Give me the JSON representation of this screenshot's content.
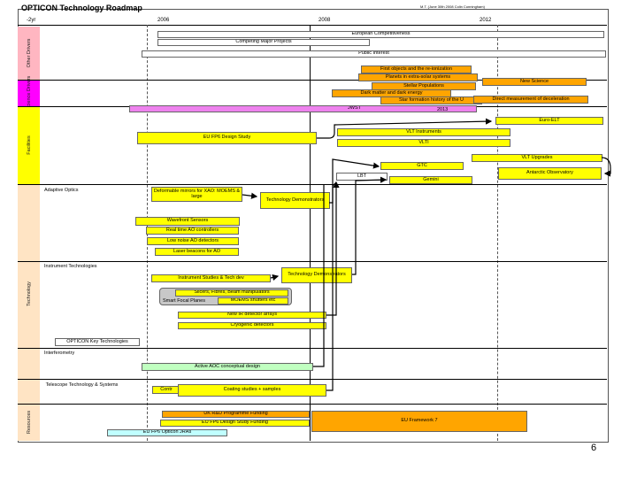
{
  "title": "OPTICON Technology Roadmap",
  "subtitle": "M.T. (June 30th 2008 Colin Cunningham)",
  "timeline": {
    "y2yr": "-2yr",
    "y2006": "2006",
    "y2008": "2008",
    "y2012": "2012"
  },
  "categories": {
    "other_drivers": "Other Drivers",
    "science_drivers": "Science Drivers",
    "facilities": "Facilities",
    "technology": "Technology",
    "resources": "Resources"
  },
  "sections": {
    "adaptive_optics": "Adaptive Optics",
    "instrument_tech": "Instrument Technologies",
    "interferometry": "Interferometry",
    "telescope_tech": "Telescope Technology & Systems"
  },
  "bars": {
    "european_comp": "European Competitiveness",
    "competing": "Competing Major Projects",
    "public_interest": "Public Interest",
    "first_objects": "First objects and the re-ionization",
    "planets": "Planets in extra-solar systems",
    "stellar_pop": "Stellar Populations",
    "new_science": "New Science",
    "dark_matter": "Dark matter and dark energy",
    "star_formation": "Star formation history of the U",
    "direct_measurement": "Direct measurement of deceleration",
    "jwst": "JWST",
    "jwst_year": "2013",
    "euro_elt": "Euro-ELT",
    "eu_fp6": "EU FP6 Design Study",
    "vlt_instruments": "VLT Instruments",
    "vlti": "VLTI",
    "vlt_upgrades": "VLT Upgrades",
    "gtc": "GTC",
    "lbt": "LBT",
    "gemini": "Gemini",
    "antarctic": "Antarctic Observatory",
    "deformable": "Deformable mirrors for XAO: MOEMS & large",
    "tech_demo_ao": "Technology Demonstrators",
    "wavefront": "Wavefront Sensors",
    "realtime": "Real time AO controllers",
    "low_noise": "Low noise AO detectors",
    "laser": "Laser beacons for AO",
    "tech_demo_inst": "Technology Demonstrators",
    "inst_studies": "Instrument Studies & Tech dev",
    "slicers": "Slicers, Fibres, Beam manipulators",
    "smart_focal": "Smart Focal Planes",
    "moems_shutters": "MOEMS shutters etc",
    "new_ir": "New IR detector arrays",
    "cryogenic": "Cryogenic detectors",
    "opticon_key": "OPTICON Key Technologies",
    "active_aoc": "Active AOC conceptual design",
    "contr": "Contr",
    "coating": "Coating studies + samples",
    "uk_rd": "UK R&D Programme Funding",
    "eu_fp6_funding": "EU FP6 Design Study Funding",
    "eu_fp7": "EU Framework 7",
    "eu_fp6_jra": "EU FP6 Opticon JRAs"
  },
  "page_number": "6",
  "colors": {
    "yellow": "#ffff00",
    "orange": "#ffa500",
    "pink": "#ee82ee",
    "gray": "#c8c8c8",
    "cyan": "#c0ffff",
    "green": "#c0ffc0",
    "category_pink": "#ffb6c1",
    "category_magenta": "#ff00ff",
    "category_peach": "#ffe4c4"
  }
}
